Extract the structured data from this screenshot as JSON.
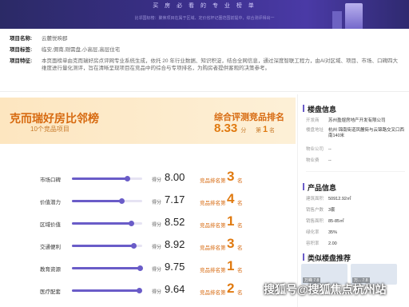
{
  "banner": {
    "title": "买 房 必 看 的 专 业 榜 单",
    "subtitle": "比邻国标榜：聚焦项目在属于区域、定价省杯记圈范围前提中，综合测评得出一"
  },
  "project": {
    "name_label": "项目名称:",
    "name_value": "云麓悦映郡",
    "tags_label": "项目标签:",
    "tags_value": "临安,佣南,刚需盘,小高层,高层住宅",
    "features_label": "项目特征:",
    "features_value": "本页面榜单由克而瑞好房点评网专业系统生成，依托 20 年行业数据、知识积淀，结合全网信息，通过深度智联工程力，由AI对区域、项目、市场、口碑四大维度进行量化测评，旨在清晰呈现项目在竞品中的综合与专项排名，为购房者提供客观的决策参考。"
  },
  "rank_card": {
    "title": "克而瑞好房比邻榜",
    "subtitle": "10个竞品项目",
    "overall_label": "综合评测竞品排名",
    "overall_score": "8.33",
    "score_unit": "分",
    "rank_prefix": "第",
    "rank_value": "1",
    "rank_suffix": "名"
  },
  "scores": [
    {
      "label": "市场口碑",
      "unit": "得分",
      "score": "8.00",
      "value": 8.0,
      "rank_label": "竞品排名第",
      "rank": "3",
      "rank_suffix": "名"
    },
    {
      "label": "价值潜力",
      "unit": "得分",
      "score": "7.17",
      "value": 7.17,
      "rank_label": "竞品排名第",
      "rank": "4",
      "rank_suffix": "名"
    },
    {
      "label": "区域价值",
      "unit": "得分",
      "score": "8.52",
      "value": 8.52,
      "rank_label": "竞品排名第",
      "rank": "1",
      "rank_suffix": "名"
    },
    {
      "label": "交通便利",
      "unit": "得分",
      "score": "8.92",
      "value": 8.92,
      "rank_label": "竞品排名第",
      "rank": "3",
      "rank_suffix": "名"
    },
    {
      "label": "教育资源",
      "unit": "得分",
      "score": "9.75",
      "value": 9.75,
      "rank_label": "竞品排名第",
      "rank": "1",
      "rank_suffix": "名"
    },
    {
      "label": "医疗配套",
      "unit": "得分",
      "score": "9.64",
      "value": 9.64,
      "rank_label": "竞品排名第",
      "rank": "2",
      "rank_suffix": "名"
    }
  ],
  "panel": {
    "building_title": "楼盘信息",
    "building_rows": [
      {
        "key": "开发商",
        "value": "苏州盈煜房地产开发有限公司"
      },
      {
        "key": "楼盘地址",
        "value": "杭州 锦南街道凤麓街与云锦路交叉口西南140米"
      },
      {
        "key": "物业公司",
        "value": "--"
      },
      {
        "key": "物业费",
        "value": "--"
      }
    ],
    "product_title": "产品信息",
    "product_rows": [
      {
        "key": "建筑面积",
        "value": "50912.92㎡"
      },
      {
        "key": "销售户数",
        "value": "3套"
      },
      {
        "key": "销售面积",
        "value": "85-85㎡"
      },
      {
        "key": "绿化率",
        "value": "35%"
      },
      {
        "key": "容积率",
        "value": "2.00"
      }
    ],
    "similar_title": "类似楼盘推荐",
    "similar_tags": [
      "万峰 7.8",
      "万... 7.8"
    ]
  },
  "watermark": "搜狐号@搜狐焦点杭州站",
  "colors": {
    "accent": "#6a5cc8",
    "rank": "#e07a10",
    "banner": "#3b2f8a"
  }
}
